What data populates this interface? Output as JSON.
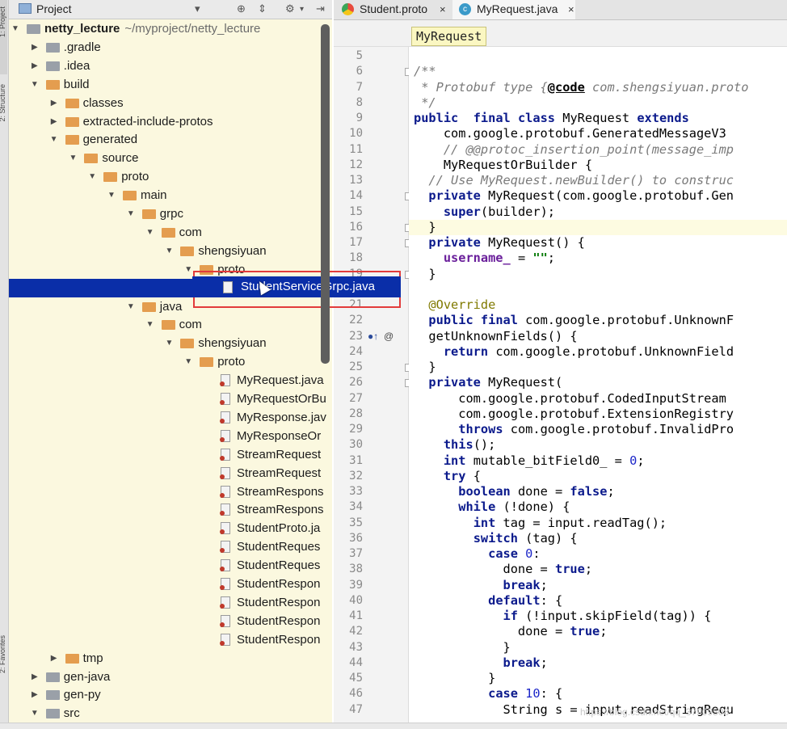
{
  "toolwindow": {
    "title": "Project",
    "side_labels": [
      "1: Project",
      "2: Structure",
      "2: Favorites"
    ]
  },
  "tree": {
    "root_name": "netty_lecture",
    "root_path": "~/myproject/netty_lecture",
    "items": [
      {
        "label": "netty_lecture",
        "depth": 0,
        "arrow": "open",
        "icon": "project"
      },
      {
        "label": ".gradle",
        "depth": 1,
        "arrow": "closed",
        "icon": "folder-grey"
      },
      {
        "label": ".idea",
        "depth": 1,
        "arrow": "closed",
        "icon": "folder-grey"
      },
      {
        "label": "build",
        "depth": 1,
        "arrow": "open",
        "icon": "folder"
      },
      {
        "label": "classes",
        "depth": 2,
        "arrow": "closed",
        "icon": "folder"
      },
      {
        "label": "extracted-include-protos",
        "depth": 2,
        "arrow": "closed",
        "icon": "folder"
      },
      {
        "label": "generated",
        "depth": 2,
        "arrow": "open",
        "icon": "folder"
      },
      {
        "label": "source",
        "depth": 3,
        "arrow": "open",
        "icon": "folder"
      },
      {
        "label": "proto",
        "depth": 4,
        "arrow": "open",
        "icon": "folder"
      },
      {
        "label": "main",
        "depth": 5,
        "arrow": "open",
        "icon": "folder"
      },
      {
        "label": "grpc",
        "depth": 6,
        "arrow": "open",
        "icon": "folder"
      },
      {
        "label": "com",
        "depth": 7,
        "arrow": "open",
        "icon": "folder"
      },
      {
        "label": "shengsiyuan",
        "depth": 8,
        "arrow": "open",
        "icon": "folder"
      },
      {
        "label": "proto",
        "depth": 9,
        "arrow": "open",
        "icon": "folder"
      },
      {
        "label": "StudentServiceGrpc.java",
        "depth": 10,
        "arrow": "none",
        "icon": "java",
        "selected": true
      },
      {
        "label": "java",
        "depth": 6,
        "arrow": "open",
        "icon": "folder"
      },
      {
        "label": "com",
        "depth": 7,
        "arrow": "open",
        "icon": "folder"
      },
      {
        "label": "shengsiyuan",
        "depth": 8,
        "arrow": "open",
        "icon": "folder"
      },
      {
        "label": "proto",
        "depth": 9,
        "arrow": "open",
        "icon": "folder"
      },
      {
        "label": "MyRequest.java",
        "depth": 10,
        "arrow": "none",
        "icon": "java"
      },
      {
        "label": "MyRequestOrBu",
        "depth": 10,
        "arrow": "none",
        "icon": "java"
      },
      {
        "label": "MyResponse.jav",
        "depth": 10,
        "arrow": "none",
        "icon": "java"
      },
      {
        "label": "MyResponseOr",
        "depth": 10,
        "arrow": "none",
        "icon": "java"
      },
      {
        "label": "StreamRequest",
        "depth": 10,
        "arrow": "none",
        "icon": "java"
      },
      {
        "label": "StreamRequest",
        "depth": 10,
        "arrow": "none",
        "icon": "java"
      },
      {
        "label": "StreamRespons",
        "depth": 10,
        "arrow": "none",
        "icon": "java"
      },
      {
        "label": "StreamRespons",
        "depth": 10,
        "arrow": "none",
        "icon": "java"
      },
      {
        "label": "StudentProto.ja",
        "depth": 10,
        "arrow": "none",
        "icon": "java"
      },
      {
        "label": "StudentReques",
        "depth": 10,
        "arrow": "none",
        "icon": "java"
      },
      {
        "label": "StudentReques",
        "depth": 10,
        "arrow": "none",
        "icon": "java"
      },
      {
        "label": "StudentRespon",
        "depth": 10,
        "arrow": "none",
        "icon": "java"
      },
      {
        "label": "StudentRespon",
        "depth": 10,
        "arrow": "none",
        "icon": "java"
      },
      {
        "label": "StudentRespon",
        "depth": 10,
        "arrow": "none",
        "icon": "java"
      },
      {
        "label": "StudentRespon",
        "depth": 10,
        "arrow": "none",
        "icon": "java"
      },
      {
        "label": "tmp",
        "depth": 2,
        "arrow": "closed",
        "icon": "folder"
      },
      {
        "label": "gen-java",
        "depth": 1,
        "arrow": "closed",
        "icon": "folder-grey"
      },
      {
        "label": "gen-py",
        "depth": 1,
        "arrow": "closed",
        "icon": "folder-grey"
      },
      {
        "label": "src",
        "depth": 1,
        "arrow": "open",
        "icon": "folder-grey"
      }
    ],
    "drag_label": "StudentServiceGrpc.java"
  },
  "editor": {
    "tabs": [
      {
        "label": "Student.proto",
        "close": "×",
        "active": false
      },
      {
        "label": "MyRequest.java",
        "close": "×",
        "active": true
      }
    ],
    "breadcrumb": "MyRequest",
    "first_line": 5,
    "lines": [
      "",
      "/**",
      " * Protobuf type {@code com.shengsiyuan.proto",
      " */",
      "public  final class MyRequest extends",
      "    com.google.protobuf.GeneratedMessageV3",
      "    // @@protoc_insertion_point(message_imp",
      "    MyRequestOrBuilder {",
      "  // Use MyRequest.newBuilder() to construc",
      "  private MyRequest(com.google.protobuf.Gen",
      "    super(builder);",
      "  }",
      "  private MyRequest() {",
      "    username_ = \"\";",
      "  }",
      "",
      "  @Override",
      "  public final com.google.protobuf.UnknownF",
      "  getUnknownFields() {",
      "    return com.google.protobuf.UnknownField",
      "  }",
      "  private MyRequest(",
      "      com.google.protobuf.CodedInputStream",
      "      com.google.protobuf.ExtensionRegistry",
      "      throws com.google.protobuf.InvalidPro",
      "    this();",
      "    int mutable_bitField0_ = 0;",
      "    try {",
      "      boolean done = false;",
      "      while (!done) {",
      "        int tag = input.readTag();",
      "        switch (tag) {",
      "          case 0:",
      "            done = true;",
      "            break;",
      "          default: {",
      "            if (!input.skipField(tag)) {",
      "              done = true;",
      "            }",
      "            break;",
      "          }",
      "          case 10: {",
      "            String s = input.readStringRequ"
    ],
    "watermark": "https://blog.csdn.net/qq_37909508"
  }
}
